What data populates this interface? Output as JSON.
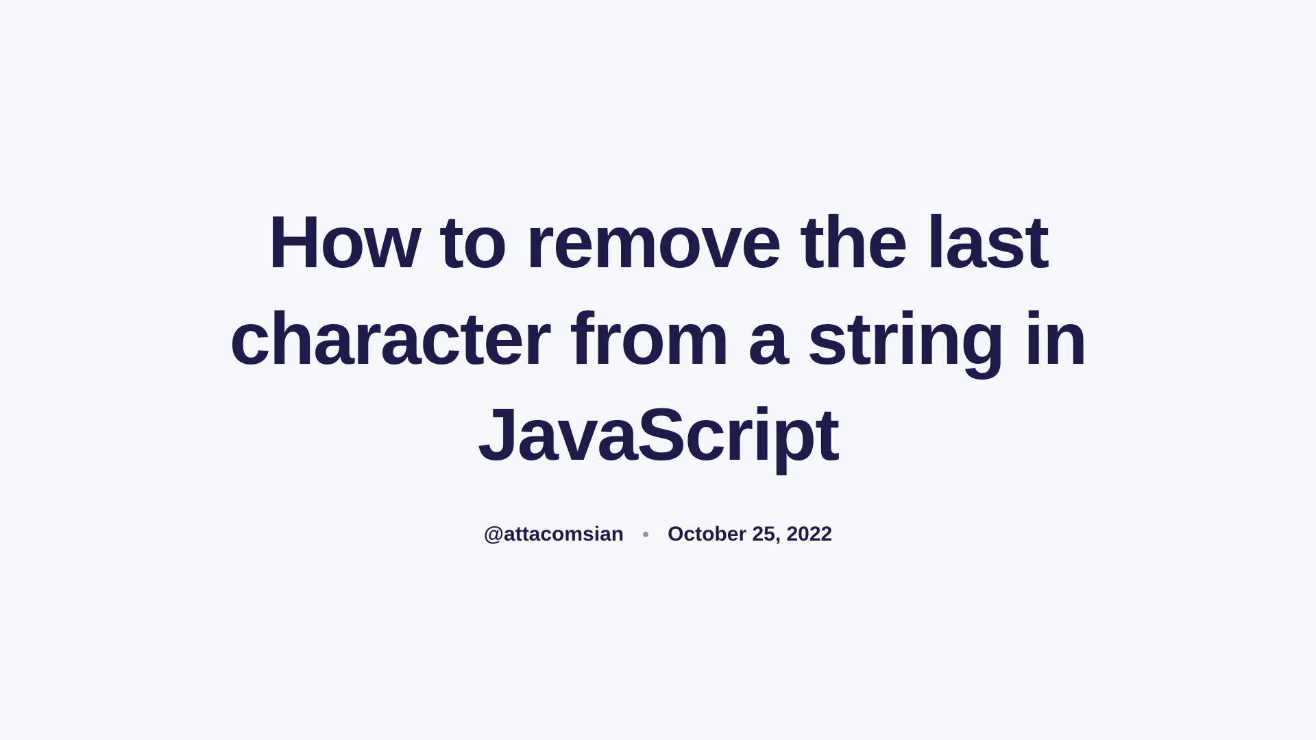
{
  "article": {
    "title": "How to remove the last character from a string in JavaScript",
    "author": "@attacomsian",
    "date": "October 25, 2022"
  }
}
